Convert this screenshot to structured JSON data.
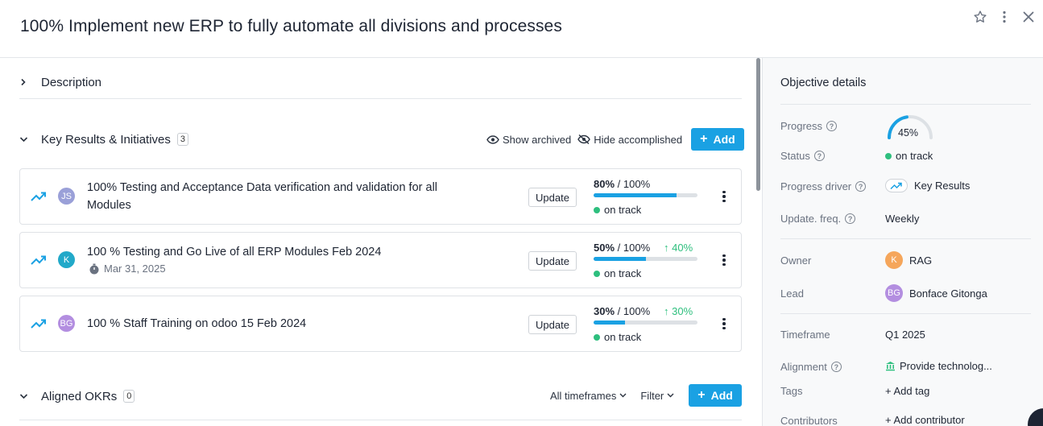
{
  "header": {
    "title": "100% Implement new ERP to fully automate all divisions and processes",
    "icons": [
      "star-icon",
      "more-vertical-icon",
      "close-icon"
    ]
  },
  "description": {
    "label": "Description"
  },
  "key_results": {
    "label": "Key Results & Initiatives",
    "count": "3",
    "show_archived": "Show archived",
    "hide_accomplished": "Hide accomplished",
    "add_label": "Add",
    "items": [
      {
        "title": "100% Testing and Acceptance Data verification and validation for all Modules",
        "avatar": "JS",
        "avatar_color": "#9aa0d8",
        "date": "",
        "update_label": "Update",
        "progress": "80%",
        "target": "/ 100%",
        "progress_fraction": 0.8,
        "delta": "",
        "status": "on track"
      },
      {
        "title": "100 % Testing and Go Live of all ERP Modules Feb 2024",
        "avatar": "K",
        "avatar_color": "#22a9c9",
        "date": "Mar 31, 2025",
        "update_label": "Update",
        "progress": "50%",
        "target": "/ 100%",
        "progress_fraction": 0.5,
        "delta": "40%",
        "status": "on track"
      },
      {
        "title": "100 % Staff Training on odoo 15 Feb 2024",
        "avatar": "BG",
        "avatar_color": "#b38ee0",
        "date": "",
        "update_label": "Update",
        "progress": "30%",
        "target": "/ 100%",
        "progress_fraction": 0.3,
        "delta": "30%",
        "status": "on track"
      }
    ]
  },
  "aligned": {
    "label": "Aligned OKRs",
    "count": "0",
    "timeframes": "All timeframes",
    "filter": "Filter",
    "add_label": "Add"
  },
  "side": {
    "heading": "Objective details",
    "progress_label": "Progress",
    "progress_value": "45%",
    "progress_fraction": 0.45,
    "status_label": "Status",
    "status_value": "on track",
    "driver_label": "Progress driver",
    "driver_value": "Key Results",
    "freq_label": "Update. freq.",
    "freq_value": "Weekly",
    "owner_label": "Owner",
    "owner_avatar": "K",
    "owner_color": "#f5a65b",
    "owner_value": "RAG",
    "lead_label": "Lead",
    "lead_avatar": "BG",
    "lead_color": "#b38ee0",
    "lead_value": "Bonface Gitonga",
    "timeframe_label": "Timeframe",
    "timeframe_value": "Q1 2025",
    "alignment_label": "Alignment",
    "alignment_value": "Provide technolog...",
    "tags_label": "Tags",
    "tags_value": "+ Add tag",
    "contributors_label": "Contributors",
    "contributors_value": "+ Add contributor"
  },
  "colors": {
    "accent": "#1aa1e3",
    "success": "#2ebf7e"
  }
}
